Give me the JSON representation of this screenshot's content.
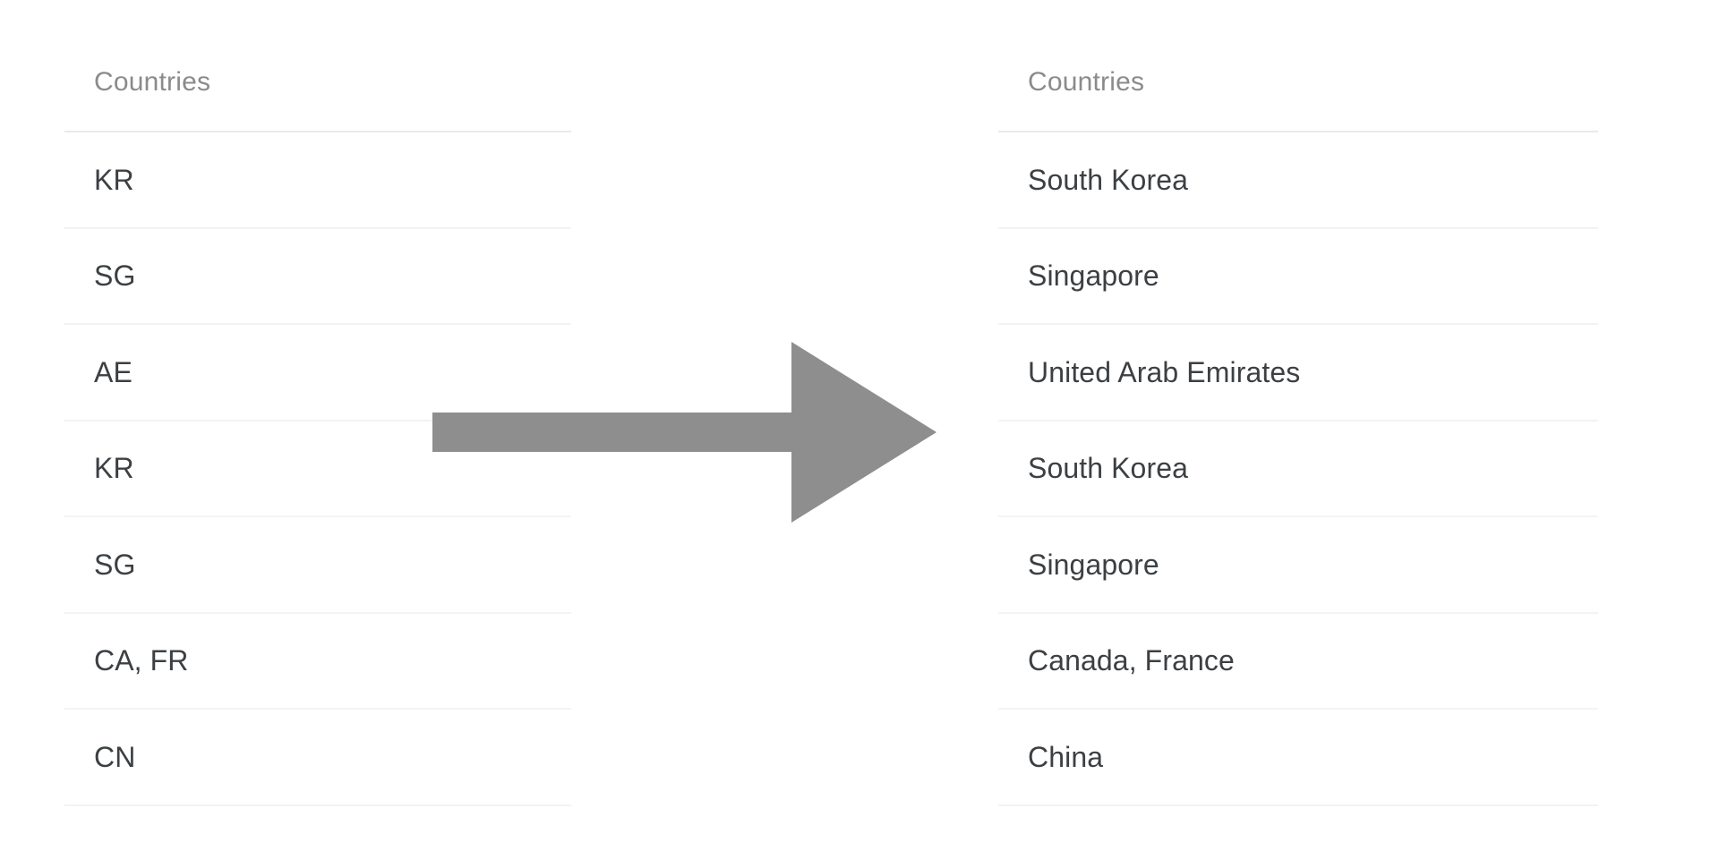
{
  "left_table": {
    "header": "Countries",
    "rows": [
      "KR",
      "SG",
      "AE",
      "KR",
      "SG",
      "CA, FR",
      "CN"
    ]
  },
  "right_table": {
    "header": "Countries",
    "rows": [
      "South Korea",
      "Singapore",
      "United Arab Emirates",
      "South Korea",
      "Singapore",
      "Canada, France",
      "China"
    ]
  },
  "arrow": {
    "icon": "arrow-right-icon",
    "color": "#8e8e8e",
    "direction": "right"
  },
  "colors": {
    "background": "#ffffff",
    "header_text": "#8b8b8b",
    "body_text": "#3c4043",
    "header_rule": "#e8eaed",
    "row_rule": "#f1f3f4",
    "arrow_fill": "#8e8e8e"
  }
}
